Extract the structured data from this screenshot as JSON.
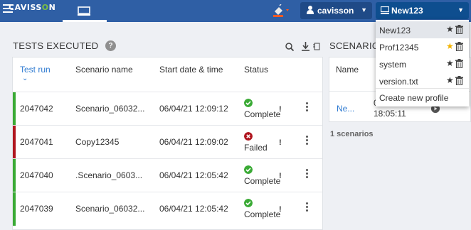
{
  "topbar": {
    "logo_text": "CAVISSON",
    "user_label": "cavisson",
    "project_label": "New123"
  },
  "panel": {
    "title": "TESTS EXECUTED",
    "help_text": "?"
  },
  "table": {
    "headers": {
      "test_run": "Test run",
      "scenario_name": "Scenario name",
      "start_date": "Start date & time",
      "status": "Status"
    },
    "rows": [
      {
        "id": "2047042",
        "scenario": "Scenario_06032...",
        "date": "06/04/21 12:09:12",
        "status": "Complete",
        "status_color": "#3aaa35"
      },
      {
        "id": "2047041",
        "scenario": "Copy12345",
        "date": "06/04/21 12:09:02",
        "status": "Failed",
        "status_color": "#b0161f"
      },
      {
        "id": "2047040",
        "scenario": ".Scenario_0603...",
        "date": "06/04/21 12:05:42",
        "status": "Complete",
        "status_color": "#3aaa35"
      },
      {
        "id": "2047039",
        "scenario": "Scenario_06032...",
        "date": "06/04/21 12:05:42",
        "status": "Complete",
        "status_color": "#3aaa35"
      }
    ]
  },
  "scenarios": {
    "title": "SCENARIO",
    "header_name": "Name",
    "row_name": "Ne...",
    "row_frag1": "0",
    "row_frag2": "18:05:11",
    "count": "1 scenarios"
  },
  "dropdown": {
    "items": [
      {
        "label": "New123",
        "star_color": "#333333",
        "selected": true
      },
      {
        "label": "Prof12345",
        "star_color": "#f2b300",
        "selected": false
      },
      {
        "label": "system",
        "star_color": "#333333",
        "selected": false
      },
      {
        "label": "version.txt",
        "star_color": "#333333",
        "selected": false
      }
    ],
    "create_label": "Create new profile"
  },
  "colors": {
    "topbar": "#2f5fa5",
    "accent_blue": "#2f7bd1",
    "complete_green": "#3aaa35",
    "failed_red": "#b0161f"
  },
  "icons": [
    "hamburger-icon",
    "monitor-icon",
    "paint-bucket-icon",
    "user-icon",
    "monitor-icon",
    "help-icon",
    "search-icon",
    "download-icon",
    "more-icon",
    "check-icon",
    "close-icon",
    "kebab-icon",
    "play-icon",
    "star-icon",
    "trash-icon"
  ]
}
